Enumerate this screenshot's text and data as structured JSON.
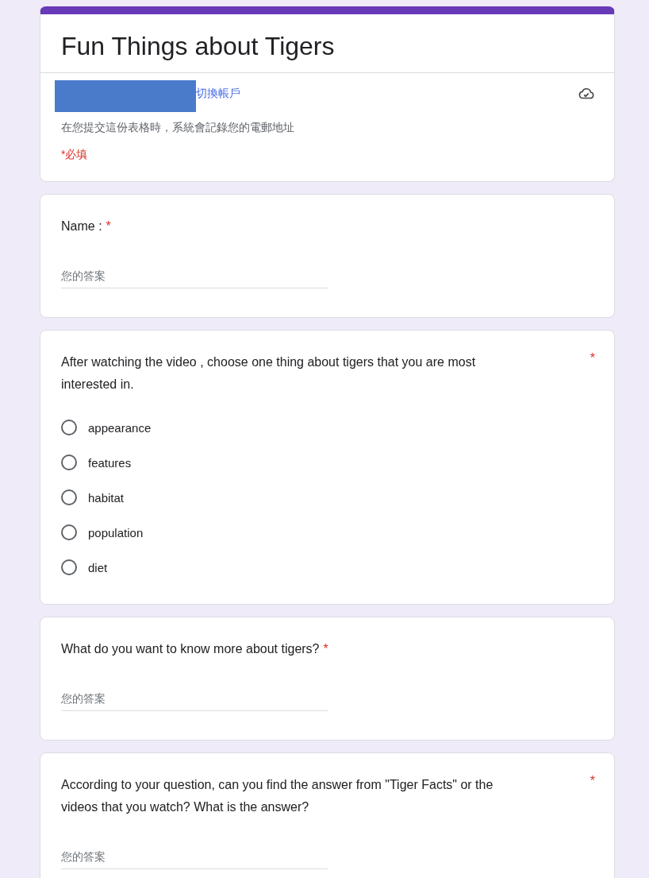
{
  "header": {
    "title": "Fun Things about Tigers",
    "switch_account": "切換帳戶",
    "notice": "在您提交這份表格時，系統會記錄您的電郵地址",
    "required_note": "*必填"
  },
  "questions": [
    {
      "kind": "text",
      "title": "Name :",
      "mark": "*",
      "mark_right": false,
      "placeholder": "您的答案"
    },
    {
      "kind": "radio",
      "title": "After watching the video , choose one thing about tigers that you are most interested in.",
      "mark": "*",
      "mark_right": true,
      "options": [
        {
          "label": "appearance",
          "selected": false
        },
        {
          "label": "features",
          "selected": false
        },
        {
          "label": "habitat",
          "selected": false
        },
        {
          "label": "population",
          "selected": false
        },
        {
          "label": "diet",
          "selected": false
        }
      ]
    },
    {
      "kind": "text",
      "title": "What do you want to know more about tigers?",
      "mark": "*",
      "mark_right": false,
      "placeholder": "您的答案"
    },
    {
      "kind": "text",
      "title": "According to your question, can you find the answer from \"Tiger Facts\" or the videos that you watch? What is the answer?",
      "mark": "*",
      "mark_right": true,
      "placeholder": "您的答案"
    }
  ]
}
